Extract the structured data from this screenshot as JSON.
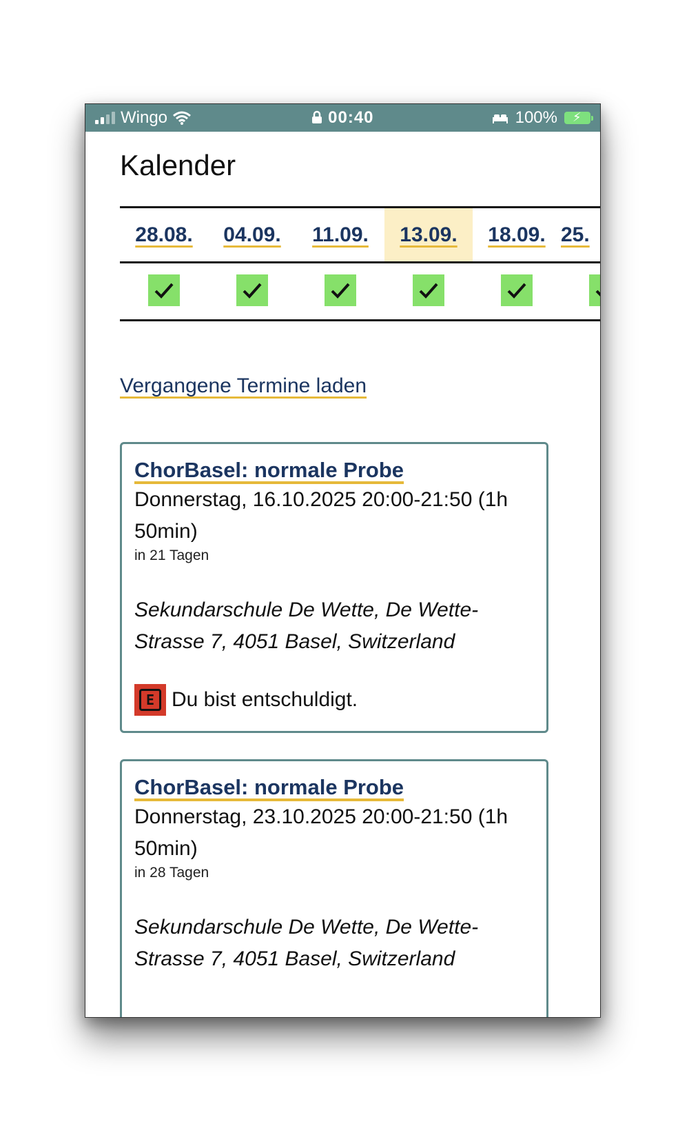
{
  "status_bar": {
    "carrier": "Wingo",
    "time": "00:40",
    "battery": "100%"
  },
  "page": {
    "title": "Kalender"
  },
  "dates": [
    {
      "label": "28.08.",
      "checked": true
    },
    {
      "label": "04.09.",
      "checked": true
    },
    {
      "label": "11.09.",
      "checked": true
    },
    {
      "label": "13.09.",
      "checked": true,
      "highlighted": true
    },
    {
      "label": "18.09.",
      "checked": true
    },
    {
      "label": "25.",
      "checked": true
    }
  ],
  "past_link": "Vergangene Termine laden",
  "events": [
    {
      "title": "ChorBasel: normale Probe",
      "when": "Donnerstag, 16.10.2025 20:00-21:50 (1h 50min)",
      "relative": "in 21 Tagen",
      "place": "Sekundarschule De Wette, De Wette-Strasse 7, 4051 Basel, Switzerland",
      "status_badge": "E",
      "status_text": "Du bist entschuldigt."
    },
    {
      "title": "ChorBasel: normale Probe",
      "when": "Donnerstag, 23.10.2025 20:00-21:50 (1h 50min)",
      "relative": "in 28 Tagen",
      "place": "Sekundarschule De Wette, De Wette-Strasse 7, 4051 Basel, Switzerland"
    }
  ],
  "colors": {
    "status_bar": "#5f8a8b",
    "link": "#1b3560",
    "underline": "#e6b93a",
    "check": "#86e06a",
    "highlight": "#fcefc6",
    "excused": "#d33a2a"
  }
}
